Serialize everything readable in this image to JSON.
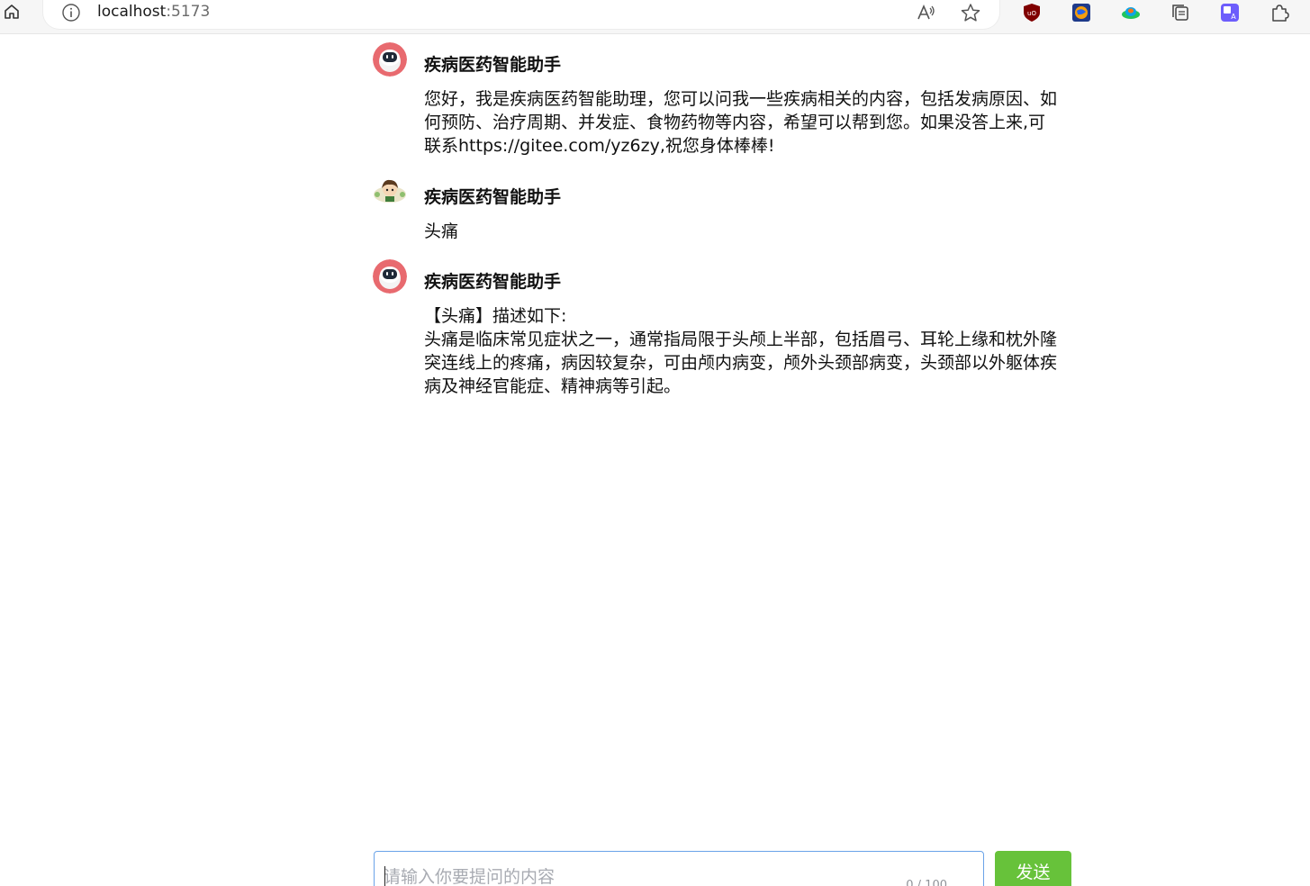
{
  "browser": {
    "url_host": "localhost",
    "url_port": ":5173"
  },
  "chat": {
    "messages": [
      {
        "role": "assistant",
        "sender": "疾病医药智能助手",
        "content": "您好，我是疾病医药智能助理，您可以问我一些疾病相关的内容，包括发病原因、如何预防、治疗周期、并发症、食物药物等内容，希望可以帮到您。如果没答上来,可联系https://gitee.com/yz6zy,祝您身体棒棒!"
      },
      {
        "role": "user",
        "sender": "疾病医药智能助手",
        "content": "头痛"
      },
      {
        "role": "assistant",
        "sender": "疾病医药智能助手",
        "content": "【头痛】描述如下:\n头痛是临床常见症状之一，通常指局限于头颅上半部，包括眉弓、耳轮上缘和枕外隆突连线上的疼痛，病因较复杂，可由颅内病变，颅外头颈部病变，头颈部以外躯体疾病及神经官能症、精神病等引起。"
      }
    ]
  },
  "input": {
    "placeholder": "请输入你要提问的内容",
    "counter": "0 / 100",
    "send_label": "发送"
  },
  "colors": {
    "send_button": "#67c23a",
    "input_border": "#6aa3e8",
    "bot_avatar_bg": "#e86a6f"
  }
}
